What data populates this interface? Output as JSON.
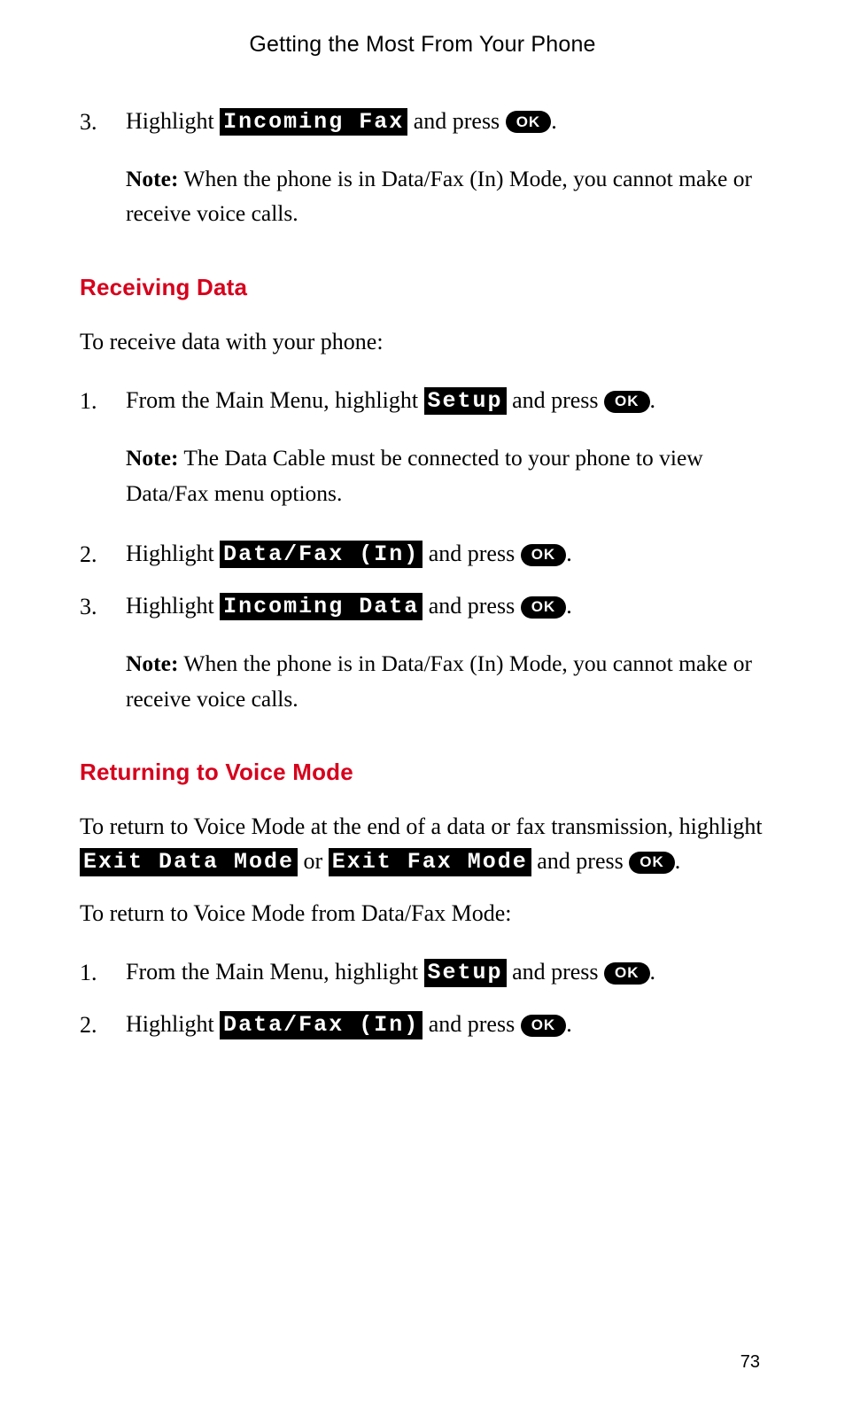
{
  "header": {
    "title": "Getting the Most From Your Phone"
  },
  "ok_label": "OK",
  "s1": {
    "step3": {
      "num": "3.",
      "pre": "Highlight ",
      "chip": "Incoming Fax",
      "post": " and press ",
      "period": "."
    },
    "note": {
      "label": "Note:",
      "text": " When the phone is in Data/Fax (In) Mode, you cannot make or receive voice calls."
    }
  },
  "s2": {
    "heading": "Receiving Data",
    "intro": "To receive data with your phone:",
    "step1": {
      "num": "1.",
      "pre": "From the Main Menu, highlight ",
      "chip": "Setup",
      "post": " and press ",
      "period": "."
    },
    "note1": {
      "label": "Note:",
      "text": " The Data Cable must be connected to your phone to view Data/Fax menu options."
    },
    "step2": {
      "num": "2.",
      "pre": "Highlight ",
      "chip": "Data/Fax (In)",
      "post": " and press ",
      "period": "."
    },
    "step3": {
      "num": "3.",
      "pre": "Highlight ",
      "chip": "Incoming Data",
      "post": " and press ",
      "period": "."
    },
    "note2": {
      "label": "Note:",
      "text": " When the phone is in Data/Fax (In) Mode, you cannot make or receive voice calls."
    }
  },
  "s3": {
    "heading": "Returning to Voice Mode",
    "para1": {
      "a": "To return to Voice Mode at the end of a data or fax transmission, highlight ",
      "chip1": "Exit Data Mode",
      "b": " or ",
      "chip2": "Exit Fax Mode",
      "c": " and press ",
      "d": "."
    },
    "intro2": "To return to Voice Mode from Data/Fax Mode:",
    "step1": {
      "num": "1.",
      "pre": "From the Main Menu, highlight ",
      "chip": "Setup",
      "post": " and press ",
      "period": "."
    },
    "step2": {
      "num": "2.",
      "pre": "Highlight ",
      "chip": "Data/Fax (In)",
      "post": " and press ",
      "period": "."
    }
  },
  "page_number": "73"
}
